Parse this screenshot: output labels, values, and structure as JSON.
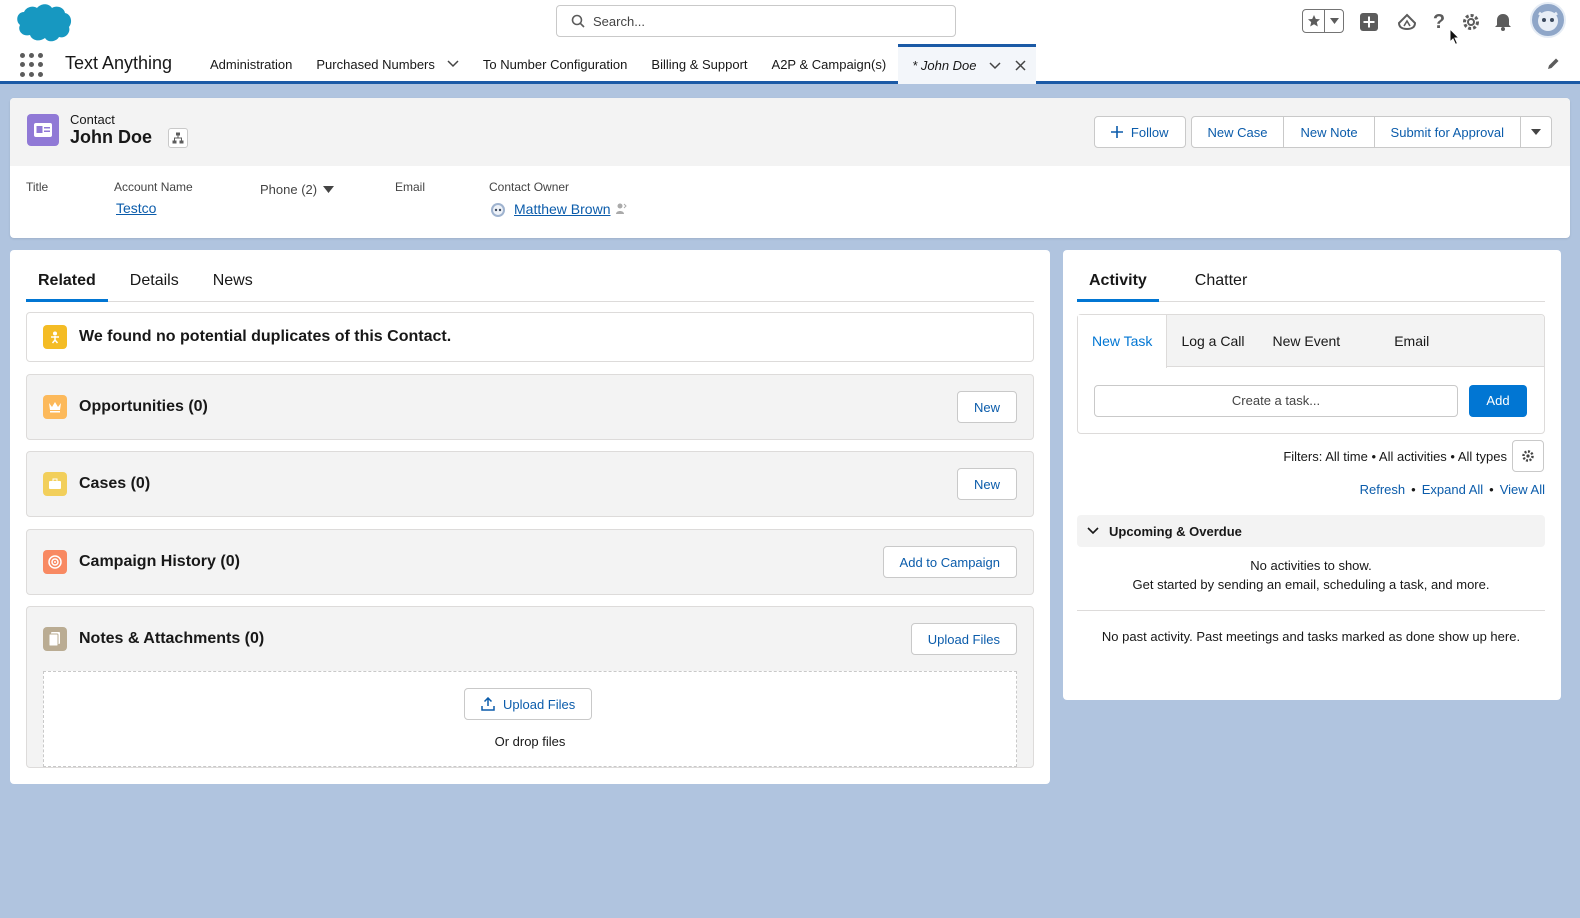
{
  "header": {
    "search_placeholder": "Search...",
    "icons": [
      "favorites-star-icon",
      "add-icon",
      "trailhead-icon",
      "help-icon",
      "setup-gear-icon",
      "notifications-bell-icon",
      "user-avatar"
    ]
  },
  "nav": {
    "app_name": "Text Anything",
    "items": [
      {
        "label": "Administration"
      },
      {
        "label": "Purchased Numbers"
      },
      {
        "label": "To Number Configuration"
      },
      {
        "label": "Billing & Support"
      },
      {
        "label": "A2P & Campaign(s)"
      }
    ],
    "active_tab": "* John Doe"
  },
  "record": {
    "object_type": "Contact",
    "name": "John Doe",
    "actions": {
      "follow": "Follow",
      "new_case": "New Case",
      "new_note": "New Note",
      "submit": "Submit for Approval"
    },
    "fields": {
      "title_label": "Title",
      "account_label": "Account Name",
      "account_value": "Testco",
      "phone_label": "Phone (2)",
      "email_label": "Email",
      "owner_label": "Contact Owner",
      "owner_value": "Matthew Brown"
    }
  },
  "main": {
    "tabs": [
      "Related",
      "Details",
      "News"
    ],
    "duplicates_msg": "We found no potential duplicates of this Contact.",
    "related": [
      {
        "title": "Opportunities (0)",
        "button": "New"
      },
      {
        "title": "Cases (0)",
        "button": "New"
      },
      {
        "title": "Campaign History (0)",
        "button": "Add to Campaign"
      },
      {
        "title": "Notes & Attachments (0)",
        "button": "Upload Files"
      }
    ],
    "upload_button": "Upload Files",
    "drop_text": "Or drop files"
  },
  "activity": {
    "tabs": [
      "Activity",
      "Chatter"
    ],
    "composer_tabs": [
      "New Task",
      "Log a Call",
      "New Event",
      "Email"
    ],
    "task_placeholder": "Create a task...",
    "add_label": "Add",
    "filters": "Filters: All time • All activities • All types",
    "links": [
      "Refresh",
      "Expand All",
      "View All"
    ],
    "upcoming_label": "Upcoming & Overdue",
    "no_activities": "No activities to show.",
    "get_started": "Get started by sending an email, scheduling a task, and more.",
    "past_msg": "No past activity. Past meetings and tasks marked as done show up here."
  },
  "colors": {
    "brand_blue": "#0176d3",
    "link_blue": "#0b5cab",
    "contact_icon": "#9079d6",
    "page_bg": "#b0c4df"
  }
}
